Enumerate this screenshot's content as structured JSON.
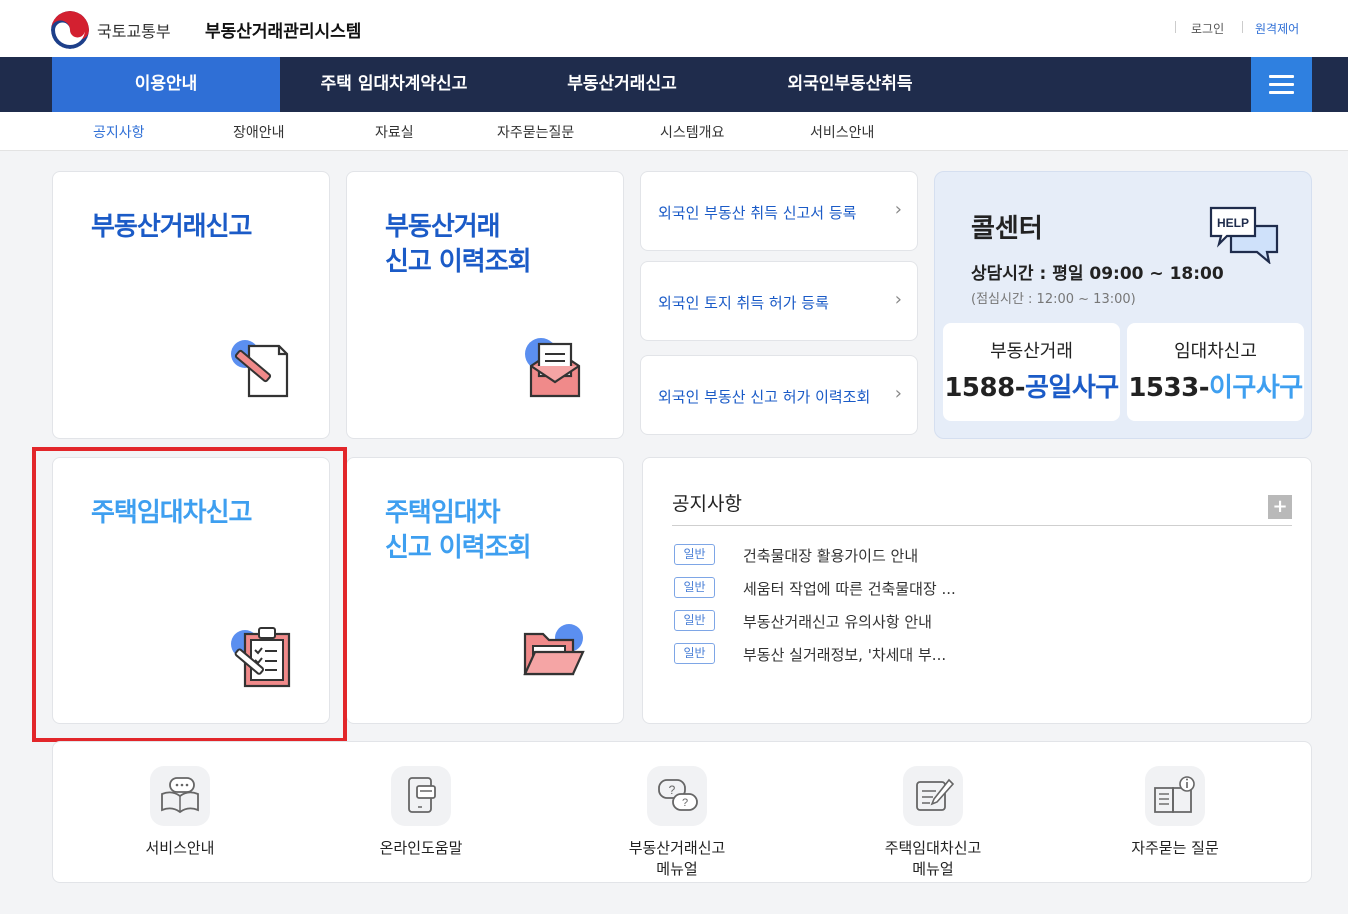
{
  "header": {
    "ministry": "국토교통부",
    "system_title": "부동산거래관리시스템",
    "login": "로그인",
    "remote": "원격제어"
  },
  "gnb": {
    "items": [
      "이용안내",
      "주택 임대차계약신고",
      "부동산거래신고",
      "외국인부동산취득"
    ],
    "active_color": "#2f6fd6",
    "bg_color": "#1f2c4c",
    "menu_icon": "hamburger-icon"
  },
  "lnb": {
    "items": [
      "공지사항",
      "장애안내",
      "자료실",
      "자주묻는질문",
      "시스템개요",
      "서비스안내"
    ]
  },
  "cards": {
    "trade_report": "부동산거래신고",
    "trade_history": "부동산거래\n신고 이력조회",
    "lease_report": "주택임대차신고",
    "lease_history": "주택임대차\n신고 이력조회"
  },
  "foreign_links": [
    "외국인 부동산 취득 신고서 등록",
    "외국인 토지 취득 허가 등록",
    "외국인 부동산 신고 허가 이력조회"
  ],
  "callcenter": {
    "title": "콜센터",
    "hours": "상담시간 : 평일 09:00 ~ 18:00",
    "lunch": "(점심시간 : 12:00 ~ 13:00)",
    "help_icon_text": "HELP",
    "trade_label": "부동산거래",
    "trade_num_prefix": "1588-",
    "trade_num_suffix": "공일사구",
    "lease_label": "임대차신고",
    "lease_num_prefix": "1533-",
    "lease_num_suffix": "이구사구"
  },
  "notice": {
    "title": "공지사항",
    "plus": "+",
    "items": [
      {
        "badge": "일반",
        "text": "건축물대장 활용가이드 안내"
      },
      {
        "badge": "일반",
        "text": "세움터 작업에 따른 건축물대장 ..."
      },
      {
        "badge": "일반",
        "text": "부동산거래신고 유의사항 안내"
      },
      {
        "badge": "일반",
        "text": "부동산 실거래정보, '차세대 부..."
      }
    ]
  },
  "quick": [
    {
      "label": "서비스안내",
      "icon": "book-chat-icon"
    },
    {
      "label": "온라인도움말",
      "icon": "tablet-chat-icon"
    },
    {
      "label": "부동산거래신고\n메뉴얼",
      "icon": "question-chat-icon"
    },
    {
      "label": "주택임대차신고\n메뉴얼",
      "icon": "note-pen-icon"
    },
    {
      "label": "자주묻는 질문",
      "icon": "book-info-icon"
    }
  ]
}
